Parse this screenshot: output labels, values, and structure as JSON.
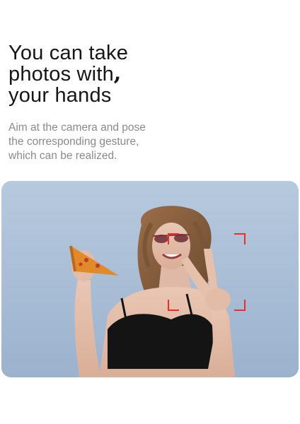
{
  "headline": {
    "lines": [
      "You can take",
      "photos with",
      "your hands"
    ],
    "mark": "‚"
  },
  "description": {
    "lines": [
      "Aim at the camera and pose",
      "the corresponding gesture,",
      "which can be realized."
    ]
  },
  "photo": {
    "subject": "woman-peace-sign-holding-pizza",
    "focus_frame_color": "#ef2b2b"
  }
}
